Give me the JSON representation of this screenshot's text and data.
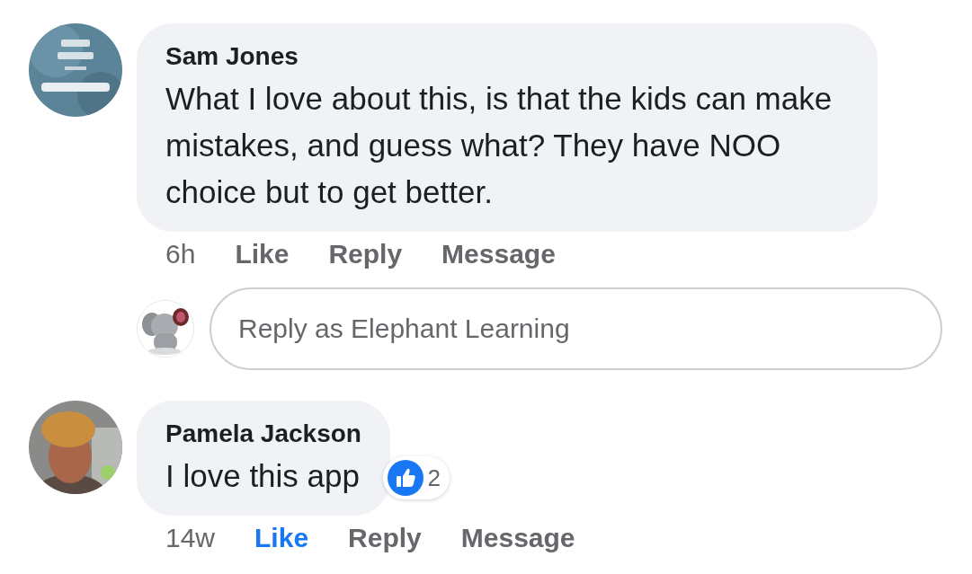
{
  "comments": [
    {
      "author": "Sam Jones",
      "text": "What I love about this, is that the kids can make mistakes,  and guess what? They have NOO choice but to get better.",
      "time": "6h",
      "actions": [
        {
          "label": "Like",
          "selected": false
        },
        {
          "label": "Reply",
          "selected": false
        },
        {
          "label": "Message",
          "selected": false
        }
      ],
      "reply_field": {
        "placeholder": "Reply as Elephant Learning"
      }
    },
    {
      "author": "Pamela Jackson",
      "text": "I love this app",
      "reaction_count": "2",
      "time": "14w",
      "actions": [
        {
          "label": "Like",
          "selected": true
        },
        {
          "label": "Reply",
          "selected": false
        },
        {
          "label": "Message",
          "selected": false
        }
      ]
    }
  ]
}
